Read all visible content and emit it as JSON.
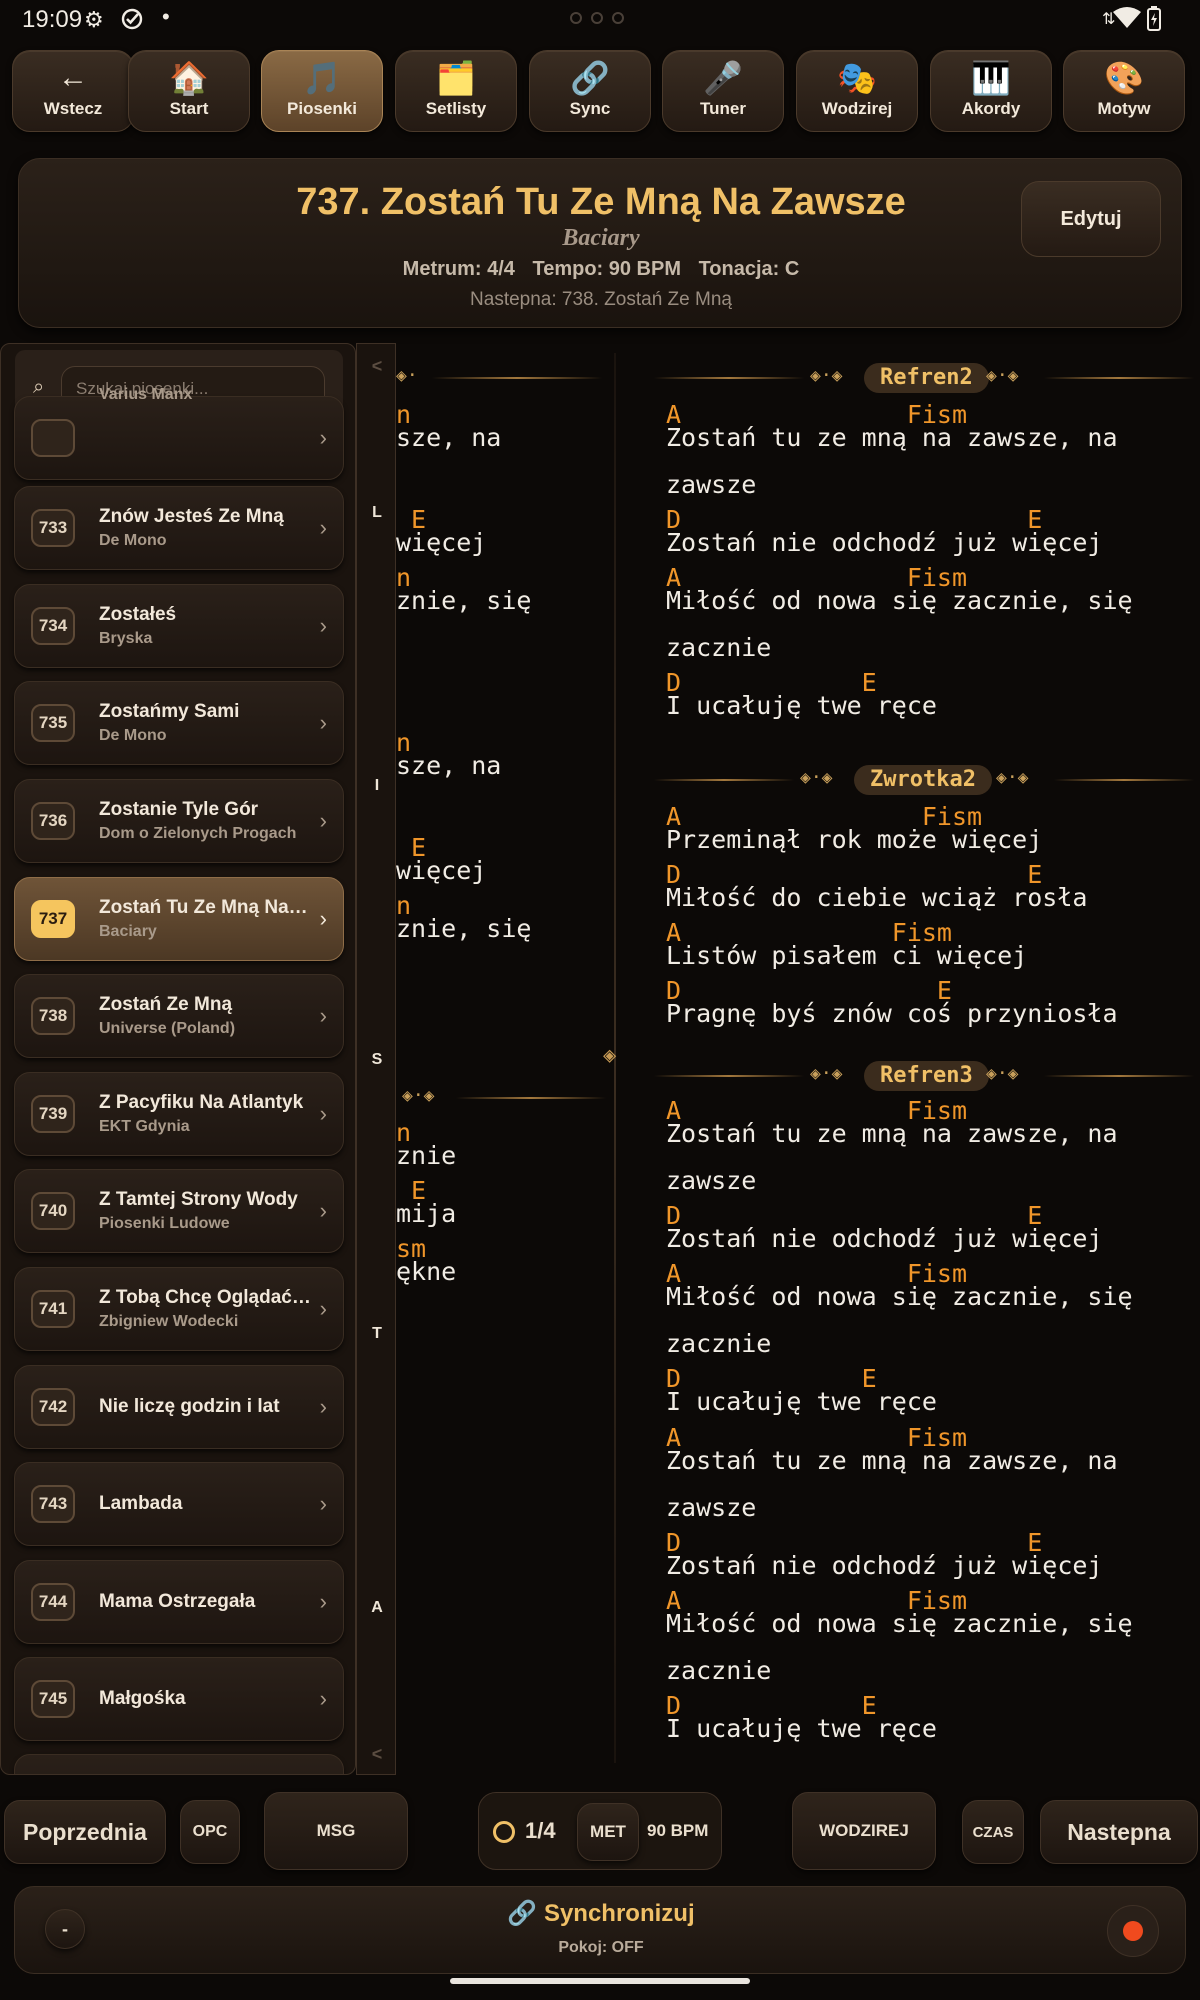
{
  "status_bar": {
    "time": "19:09"
  },
  "nav": [
    {
      "label": "Wstecz",
      "icon": "←",
      "icon_name": "arrow-left-icon"
    },
    {
      "label": "Start",
      "icon": "🏠",
      "icon_name": "home-icon"
    },
    {
      "label": "Piosenki",
      "icon": "🎵",
      "icon_name": "music-note-icon",
      "active": true
    },
    {
      "label": "Setlisty",
      "icon": "🗂️",
      "icon_name": "folder-icon"
    },
    {
      "label": "Sync",
      "icon": "🔗",
      "icon_name": "link-icon"
    },
    {
      "label": "Tuner",
      "icon": "🎤",
      "icon_name": "microphone-icon"
    },
    {
      "label": "Wodzirej",
      "icon": "🎭",
      "icon_name": "masks-icon"
    },
    {
      "label": "Akordy",
      "icon": "🎹",
      "icon_name": "piano-icon"
    },
    {
      "label": "Motyw",
      "icon": "🎨",
      "icon_name": "palette-icon"
    }
  ],
  "header": {
    "title": "737. Zostań Tu Ze Mną Na Zawsze",
    "artist": "Baciary",
    "meter": "Metrum: 4/4",
    "tempo": "Tempo: 90 BPM",
    "key": "Tonacja: C",
    "next": "Nastepna: 738. Zostań Ze Mną",
    "edit_label": "Edytuj"
  },
  "search": {
    "placeholder": "Szukaj piosenki..."
  },
  "song_list": [
    {
      "num": "",
      "title": "",
      "artist": "Varius Manx"
    },
    {
      "num": "733",
      "title": "Znów Jesteś Ze Mną",
      "artist": "De Mono"
    },
    {
      "num": "734",
      "title": "Zostałeś",
      "artist": "Bryska"
    },
    {
      "num": "735",
      "title": "Zostańmy Sami",
      "artist": "De Mono"
    },
    {
      "num": "736",
      "title": "Zostanie Tyle Gór",
      "artist": "Dom o Zielonych Progach"
    },
    {
      "num": "737",
      "title": "Zostań Tu Ze Mną Na Zawsze",
      "artist": "Baciary",
      "active": true
    },
    {
      "num": "738",
      "title": "Zostań Ze Mną",
      "artist": "Universe (Poland)"
    },
    {
      "num": "739",
      "title": "Z Pacyfiku Na Atlantyk",
      "artist": "EKT Gdynia"
    },
    {
      "num": "740",
      "title": "Z Tamtej Strony Wody",
      "artist": "Piosenki Ludowe"
    },
    {
      "num": "741",
      "title": "Z Tobą Chcę Oglądać Świat",
      "artist": "Zbigniew Wodecki"
    },
    {
      "num": "742",
      "title": "Nie liczę godzin i lat",
      "artist": ""
    },
    {
      "num": "743",
      "title": "Lambada",
      "artist": ""
    },
    {
      "num": "744",
      "title": "Mama Ostrzegała",
      "artist": ""
    },
    {
      "num": "745",
      "title": "Małgośka",
      "artist": ""
    }
  ],
  "alpha_index": [
    "<",
    "L",
    "I",
    "S",
    "T",
    "A",
    "<"
  ],
  "left_column_fragments": [
    {
      "type": "head"
    },
    {
      "chord": "n",
      "lyric": "sze, na"
    },
    {
      "chord": " E",
      "lyric": "więcej"
    },
    {
      "chord": "n",
      "lyric": "znie, się"
    },
    {
      "chord": "n",
      "lyric": "sze, na"
    },
    {
      "chord": " E",
      "lyric": "więcej"
    },
    {
      "chord": "n",
      "lyric": "znie, się"
    },
    {
      "type": "head"
    },
    {
      "chord": "n",
      "lyric": "znie"
    },
    {
      "chord": " E",
      "lyric": "mija"
    },
    {
      "chord": "sm",
      "lyric": "ękne"
    }
  ],
  "sections": {
    "refren2": "Refren2",
    "zwrotka2": "Zwrotka2",
    "refren3": "Refren3"
  },
  "lyrics_right": {
    "refren2": [
      {
        "chord": "A               Fism",
        "lyric": "Zostań tu ze mną na zawsze, na"
      },
      {
        "chord": "",
        "lyric": "zawsze"
      },
      {
        "chord": "D                       E",
        "lyric": "Zostań nie odchodź już więcej"
      },
      {
        "chord": "A               Fism",
        "lyric": "Miłość od nowa się zacznie, się"
      },
      {
        "chord": "",
        "lyric": "zacznie"
      },
      {
        "chord": "D            E",
        "lyric": "I ucałuję twe ręce"
      }
    ],
    "zwrotka2": [
      {
        "chord": "A                Fism",
        "lyric": "Przeminął rok może więcej"
      },
      {
        "chord": "D                       E",
        "lyric": "Miłość do ciebie wciąż rosła"
      },
      {
        "chord": "A              Fism",
        "lyric": "Listów pisałem ci więcej"
      },
      {
        "chord": "D                 E",
        "lyric": "Pragnę byś znów coś przyniosła"
      }
    ],
    "refren3": [
      {
        "chord": "A               Fism",
        "lyric": "Zostań tu ze mną na zawsze, na"
      },
      {
        "chord": "",
        "lyric": "zawsze"
      },
      {
        "chord": "D                       E",
        "lyric": "Zostań nie odchodź już więcej"
      },
      {
        "chord": "A               Fism",
        "lyric": "Miłość od nowa się zacznie, się"
      },
      {
        "chord": "",
        "lyric": "zacznie"
      },
      {
        "chord": "D            E",
        "lyric": "I ucałuję twe ręce"
      },
      {
        "chord": "A               Fism",
        "lyric": "Zostań tu ze mną na zawsze, na"
      },
      {
        "chord": "",
        "lyric": "zawsze"
      },
      {
        "chord": "D                       E",
        "lyric": "Zostań nie odchodź już więcej"
      },
      {
        "chord": "A               Fism",
        "lyric": "Miłość od nowa się zacznie, się"
      },
      {
        "chord": "",
        "lyric": "zacznie"
      },
      {
        "chord": "D            E",
        "lyric": "I ucałuję twe ręce"
      }
    ]
  },
  "controls": {
    "prev": "Poprzednia",
    "opc": "OPC",
    "msg": "MSG",
    "beat": "1/4",
    "met": "MET",
    "bpm": "90 BPM",
    "wodzirej": "WODZIREJ",
    "czas": "CZAS",
    "next": "Nastepna"
  },
  "sync": {
    "icon": "🔗",
    "title": "Synchronizuj",
    "room": "Pokoj: OFF",
    "minus": "-"
  },
  "colors": {
    "accent": "#f0c067",
    "chord": "#f0962a",
    "record": "#f04a1e"
  }
}
